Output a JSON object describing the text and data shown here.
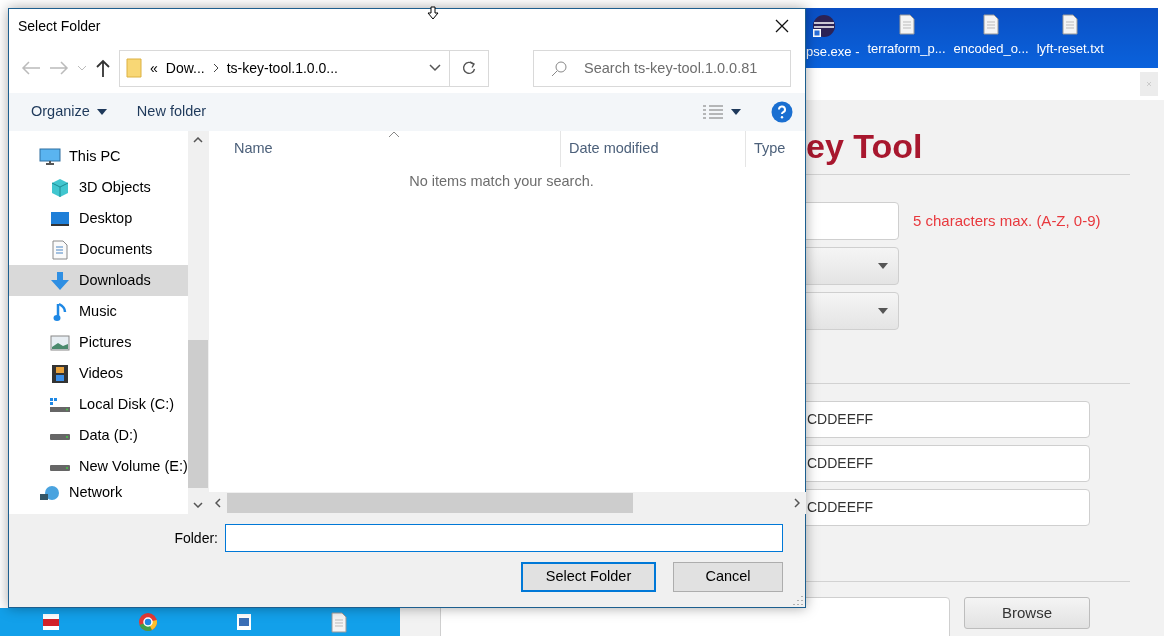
{
  "desktop_icons": [
    {
      "label": "pse.exe -",
      "kind": "app"
    },
    {
      "label": "terraform_p...",
      "kind": "file"
    },
    {
      "label": "encoded_o...",
      "kind": "file"
    },
    {
      "label": "lyft-reset.txt",
      "kind": "file"
    }
  ],
  "dock_icons": [
    {
      "kind": "pdf"
    },
    {
      "kind": "browser"
    },
    {
      "kind": "image"
    },
    {
      "kind": "file"
    }
  ],
  "app": {
    "title": "ey Tool",
    "hint": "5 characters max. (A-Z, 0-9)",
    "hex_fields": [
      "CDDEEFF",
      "CDDEEFF",
      "CDDEEFF"
    ],
    "browse_button": "Browse"
  },
  "dialog": {
    "title": "Select Folder",
    "address": {
      "overflow_mark": "«",
      "crumbs": [
        "Dow...",
        "ts-key-tool.1.0.0..."
      ]
    },
    "search": {
      "placeholder": "Search ts-key-tool.1.0.0.81"
    },
    "toolbar": {
      "organize": "Organize",
      "new_folder": "New folder"
    },
    "nav": [
      {
        "label": "This PC",
        "kind": "pc",
        "selected": false,
        "children": [
          {
            "label": "3D Objects",
            "kind": "cube",
            "selected": false
          },
          {
            "label": "Desktop",
            "kind": "desktop",
            "selected": false
          },
          {
            "label": "Documents",
            "kind": "documents",
            "selected": false
          },
          {
            "label": "Downloads",
            "kind": "download",
            "selected": true
          },
          {
            "label": "Music",
            "kind": "music",
            "selected": false
          },
          {
            "label": "Pictures",
            "kind": "pictures",
            "selected": false
          },
          {
            "label": "Videos",
            "kind": "videos",
            "selected": false
          },
          {
            "label": "Local Disk (C:)",
            "kind": "system-disk",
            "selected": false
          },
          {
            "label": "Data (D:)",
            "kind": "drive",
            "selected": false
          },
          {
            "label": "New Volume (E:)",
            "kind": "drive",
            "selected": false
          }
        ]
      },
      {
        "label": "Network",
        "kind": "network",
        "selected": false
      }
    ],
    "columns": [
      "Name",
      "Date modified",
      "Type"
    ],
    "empty_message": "No items match your search.",
    "folder_label": "Folder:",
    "buttons": [
      {
        "label": "Select Folder",
        "default": true
      },
      {
        "label": "Cancel",
        "default": false
      }
    ]
  }
}
